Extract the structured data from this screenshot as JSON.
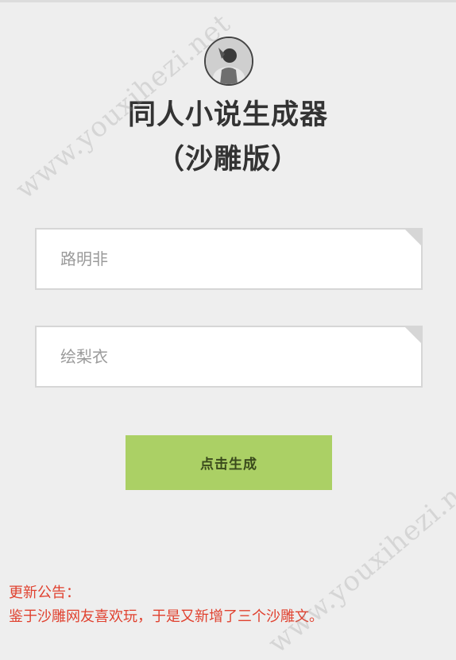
{
  "header": {
    "title_line1": "同人小说生成器",
    "title_line2": "（沙雕版）"
  },
  "form": {
    "name1_placeholder": "路明非",
    "name2_placeholder": "绘梨衣",
    "generate_label": "点击生成"
  },
  "notice": {
    "title": "更新公告：",
    "body": "鉴于沙雕网友喜欢玩，于是又新增了三个沙雕文。"
  },
  "watermark": {
    "text": "www.youxihezi.net"
  },
  "colors": {
    "background": "#eeeeee",
    "button": "#abd065",
    "notice": "#e0412f",
    "title": "#333333"
  },
  "icons": {
    "avatar": "avatar-photo-icon",
    "field_corner": "corner-fold-icon"
  }
}
